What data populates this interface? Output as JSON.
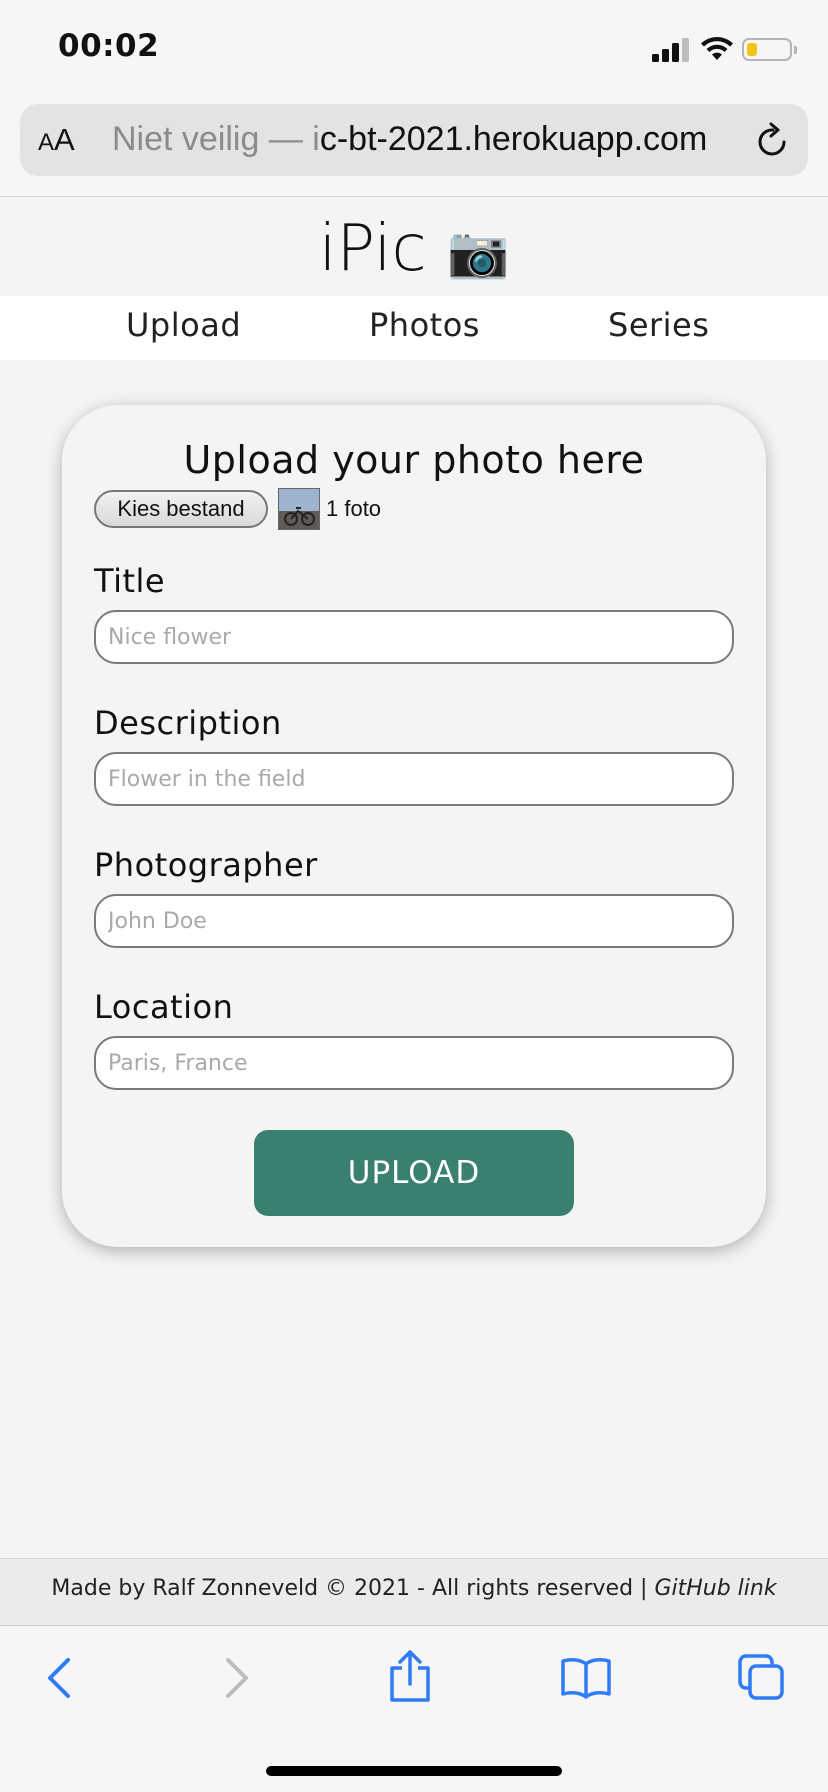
{
  "status_bar": {
    "time": "00:02"
  },
  "address_bar": {
    "text_size_label_small": "A",
    "text_size_label_large": "A",
    "url_prefix": "Niet veilig — ",
    "url_partial": "i",
    "url_domain": "c-bt-2021.herokuapp.com"
  },
  "header": {
    "title": "iPic",
    "camera_emoji": "📷"
  },
  "nav": {
    "items": [
      "Upload",
      "Photos",
      "Series"
    ]
  },
  "form": {
    "heading": "Upload your photo here",
    "file_button_label": "Kies bestand",
    "file_count": "1 foto",
    "fields": [
      {
        "label": "Title",
        "placeholder": "Nice flower"
      },
      {
        "label": "Description",
        "placeholder": "Flower in the field"
      },
      {
        "label": "Photographer",
        "placeholder": "John Doe"
      },
      {
        "label": "Location",
        "placeholder": "Paris, France"
      }
    ],
    "submit_label": "UPLOAD"
  },
  "footer": {
    "text": "Made by Ralf Zonneveld © 2021 - All rights reserved | ",
    "link_label": "GitHub link"
  },
  "colors": {
    "accent": "#3a8071",
    "safari_blue": "#2f7cf6",
    "battery": "#f2c418"
  }
}
